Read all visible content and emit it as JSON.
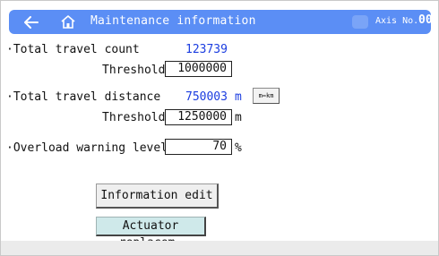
{
  "header": {
    "title": "Maintenance information",
    "back_icon": "arrow-left-icon",
    "home_icon": "home-icon",
    "axis_label": "Axis No.",
    "axis_number": "00"
  },
  "travel_count": {
    "label": "·Total travel count",
    "value": "123739",
    "threshold_label": "Threshold",
    "threshold_value": "1000000"
  },
  "travel_distance": {
    "label": "·Total travel distance",
    "value": "750003",
    "unit": "m",
    "toggle_label": "m⇔km",
    "threshold_label": "Threshold",
    "threshold_value": "1250000",
    "threshold_unit": "m"
  },
  "overload": {
    "label": "·Overload warning level",
    "value": "70",
    "unit": "%"
  },
  "buttons": {
    "info_edit": "Information edit",
    "actuator_replace": "Actuator replacem."
  },
  "colors": {
    "header_bg": "#5b8ef5",
    "value_blue": "#1b3de0",
    "replace_btn_bg": "#cfe9ea"
  }
}
